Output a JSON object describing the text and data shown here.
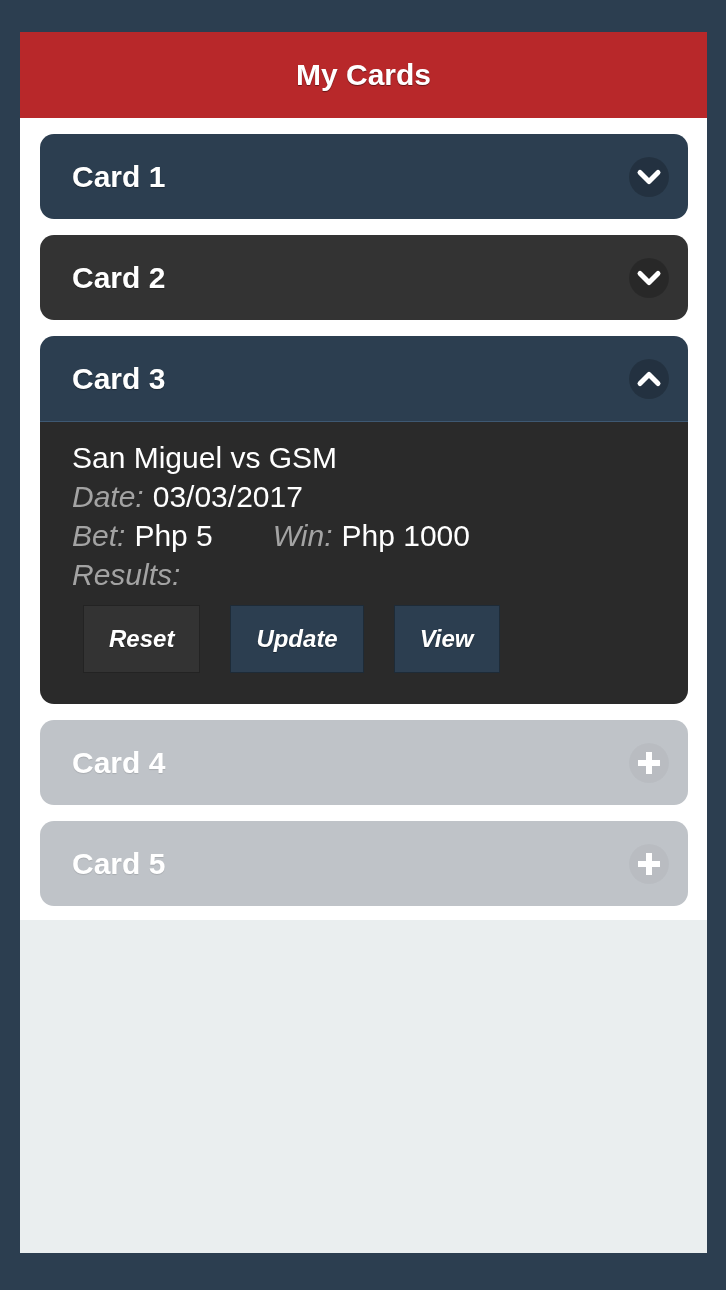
{
  "header": {
    "title": "My Cards"
  },
  "cards": [
    {
      "title": "Card 1",
      "color": "#2c3e50",
      "expanded": false,
      "disabled": false
    },
    {
      "title": "Card 2",
      "color": "#333333",
      "expanded": false,
      "disabled": false
    },
    {
      "title": "Card 3",
      "color": "#2c3e50",
      "expanded": true,
      "disabled": false,
      "details": {
        "match": "San Miguel vs GSM",
        "rows": [
          [
            {
              "label": "Date:",
              "value": "03/03/2017"
            }
          ],
          [
            {
              "label": "Bet:",
              "value": "Php 5"
            },
            {
              "label": "Win:",
              "value": "Php 1000"
            }
          ],
          [
            {
              "label": "Results:"
            }
          ]
        ],
        "buttons": [
          {
            "label": "Reset",
            "color": "#333333"
          },
          {
            "label": "Update",
            "color": "#2c3e50"
          },
          {
            "label": "View",
            "color": "#2c3e50"
          }
        ]
      }
    },
    {
      "title": "Card 4",
      "color": "#bfc3c8",
      "expanded": false,
      "disabled": true
    },
    {
      "title": "Card 5",
      "color": "#bfc3c8",
      "expanded": false,
      "disabled": true
    }
  ]
}
